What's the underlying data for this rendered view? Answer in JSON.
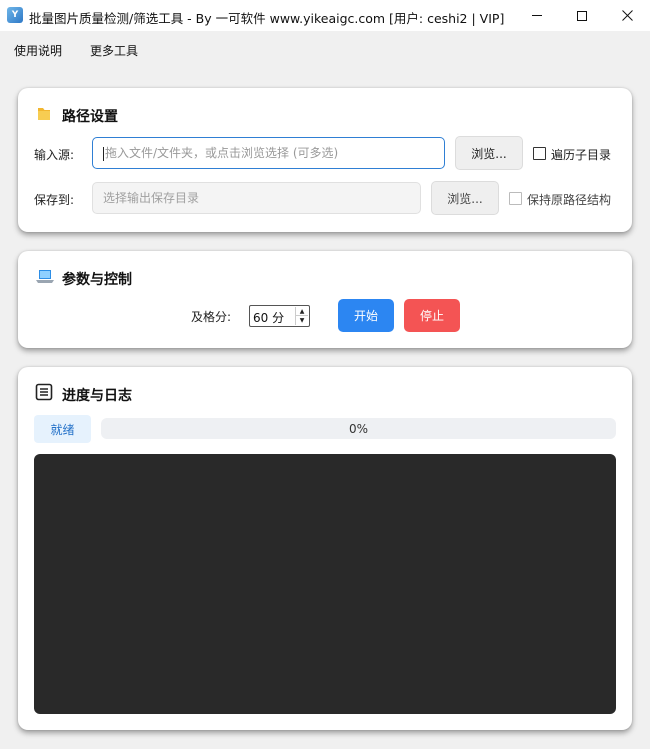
{
  "window": {
    "title": "批量图片质量检测/筛选工具 - By 一可软件 www.yikeaigc.com [用户: ceshi2 | VIP]",
    "app_icon": "app-logo-icon"
  },
  "menu": {
    "items": [
      "使用说明",
      "更多工具"
    ]
  },
  "path_section": {
    "title": "路径设置",
    "icon": "folder-icon",
    "input": {
      "label": "输入源:",
      "placeholder": "拖入文件/文件夹，或点击浏览选择 (可多选)",
      "value": "",
      "browse_label": "浏览...",
      "checkbox_label": "遍历子目录",
      "checked": false
    },
    "output": {
      "label": "保存到:",
      "placeholder": "选择输出保存目录",
      "value": "",
      "browse_label": "浏览...",
      "checkbox_label": "保持原路径结构",
      "checked": false
    }
  },
  "params_section": {
    "title": "参数与控制",
    "icon": "laptop-icon",
    "pass_score_label": "及格分:",
    "pass_score_value": "60 分",
    "start_label": "开始",
    "stop_label": "停止"
  },
  "progress_section": {
    "title": "进度与日志",
    "icon": "list-icon",
    "status": "就绪",
    "progress_percent": 0,
    "progress_text": "0%",
    "log_text": ""
  },
  "colors": {
    "accent": "#2c86f2",
    "danger": "#f45454",
    "log_bg": "#292929",
    "status_bg": "#e6f2fd",
    "status_text": "#2270c8"
  }
}
